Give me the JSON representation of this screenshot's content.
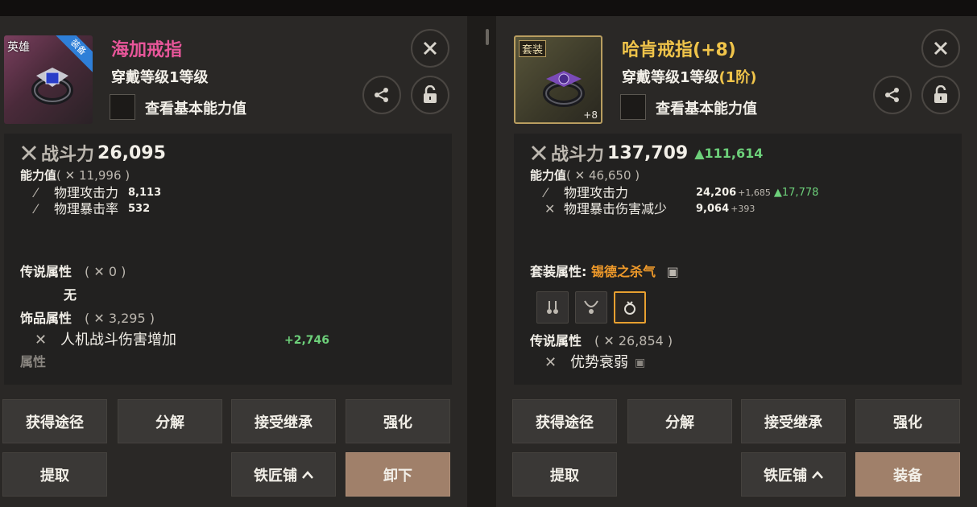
{
  "left": {
    "rarity": "英雄",
    "ribbon": "装备",
    "title": "海加戒指",
    "wear_level": "穿戴等级1等级",
    "tier": "",
    "view_base": "查看基本能力值",
    "combat_label": "战斗力",
    "combat_value": "26,095",
    "ability_label": "能力值",
    "ability_value": "11,996",
    "attrs": [
      {
        "name": "物理攻击力",
        "value": "8,113"
      },
      {
        "name": "物理暴击率",
        "value": "532"
      }
    ],
    "legend_label": "传说属性",
    "legend_value": "0",
    "legend_none": "无",
    "ornament_label": "饰品属性",
    "ornament_value": "3,295",
    "ornament_attr": {
      "name": "人机战斗伤害增加",
      "value": "+2,746"
    },
    "cut_text": "属性",
    "buttons": [
      "获得途径",
      "分解",
      "接受继承",
      "强化",
      "提取",
      "铁匠铺",
      "卸下"
    ]
  },
  "right": {
    "rarity": "套装",
    "plus_badge": "+8",
    "title": "哈肯戒指",
    "title_plus": "(+8)",
    "wear_level": "穿戴等级1等级",
    "tier": "(1阶)",
    "view_base": "查看基本能力值",
    "combat_label": "战斗力",
    "combat_value": "137,709",
    "combat_delta": "▲111,614",
    "ability_label": "能力值",
    "ability_value": "46,650",
    "attrs": [
      {
        "name": "物理攻击力",
        "value": "24,206",
        "bonus": "+1,685",
        "delta": "▲17,778"
      },
      {
        "name": "物理暴击伤害减少",
        "value": "9,064",
        "bonus": "+393",
        "delta": ""
      }
    ],
    "set_label": "套装属性:",
    "set_name": "锡德之杀气",
    "legend_label": "传说属性",
    "legend_value": "26,854",
    "legend_attr": "优势衰弱",
    "buttons": [
      "获得途径",
      "分解",
      "接受继承",
      "强化",
      "提取",
      "铁匠铺",
      "装备"
    ]
  },
  "colors": {
    "hero_title": "#e8569a",
    "set_title": "#f0c44a",
    "increase": "#6dd07a",
    "set_name": "#f09a2a"
  },
  "icons": [
    "close-icon",
    "share-icon",
    "lock-icon",
    "crossed-swords-icon",
    "caret-up-icon"
  ]
}
